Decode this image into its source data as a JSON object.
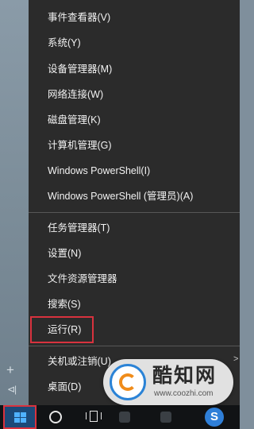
{
  "menu": {
    "items": [
      {
        "label": "事件查看器(V)"
      },
      {
        "label": "系统(Y)"
      },
      {
        "label": "设备管理器(M)"
      },
      {
        "label": "网络连接(W)"
      },
      {
        "label": "磁盘管理(K)"
      },
      {
        "label": "计算机管理(G)"
      },
      {
        "label": "Windows PowerShell(I)"
      },
      {
        "label": "Windows PowerShell (管理员)(A)"
      },
      {
        "label": "任务管理器(T)"
      },
      {
        "label": "设置(N)"
      },
      {
        "label": "文件资源管理器"
      },
      {
        "label": "搜索(S)"
      },
      {
        "label": "运行(R)"
      },
      {
        "label": "关机或注销(U)"
      },
      {
        "label": "桌面(D)"
      }
    ],
    "highlighted_item": "运行(R)",
    "highlight_color": "#d8323e"
  },
  "side_panel": {
    "plus_glyph": "+",
    "collapse_glyph": "⊲|"
  },
  "taskbar": {
    "icons": [
      "windows-start-icon",
      "cortana-circle-icon",
      "task-view-icon",
      "taskbar-app-icon",
      "taskbar-app-icon",
      "sogou-input-icon"
    ],
    "sogou_glyph": "S"
  },
  "watermark": {
    "name": "酷知网",
    "url": "www.coozhi.com"
  }
}
